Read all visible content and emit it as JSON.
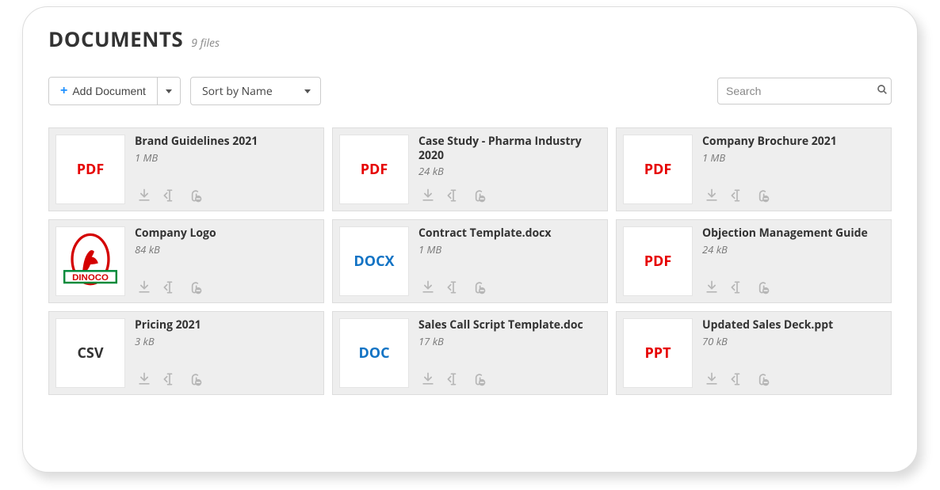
{
  "header": {
    "title": "DOCUMENTS",
    "subtitle": "9 files"
  },
  "toolbar": {
    "add_label": "Add Document",
    "sort_label": "Sort by Name",
    "search_placeholder": "Search"
  },
  "documents": [
    {
      "title": "Brand Guidelines 2021",
      "size": "1 MB",
      "type": "PDF",
      "badge": "PDF"
    },
    {
      "title": "Case Study - Pharma Industry 2020",
      "size": "24 kB",
      "type": "PDF",
      "badge": "PDF"
    },
    {
      "title": "Company Brochure 2021",
      "size": "1 MB",
      "type": "PDF",
      "badge": "PDF"
    },
    {
      "title": "Company Logo",
      "size": "84 kB",
      "type": "LOGO",
      "badge": ""
    },
    {
      "title": "Contract Template.docx",
      "size": "1 MB",
      "type": "DOCX",
      "badge": "DOCX"
    },
    {
      "title": "Objection Management Guide",
      "size": "24 kB",
      "type": "PDF",
      "badge": "PDF"
    },
    {
      "title": "Pricing 2021",
      "size": "3 kB",
      "type": "CSV",
      "badge": "CSV"
    },
    {
      "title": "Sales Call Script Template.doc",
      "size": "17 kB",
      "type": "DOC",
      "badge": "DOC"
    },
    {
      "title": "Updated Sales Deck.ppt",
      "size": "70 kB",
      "type": "PPT",
      "badge": "PPT"
    }
  ]
}
